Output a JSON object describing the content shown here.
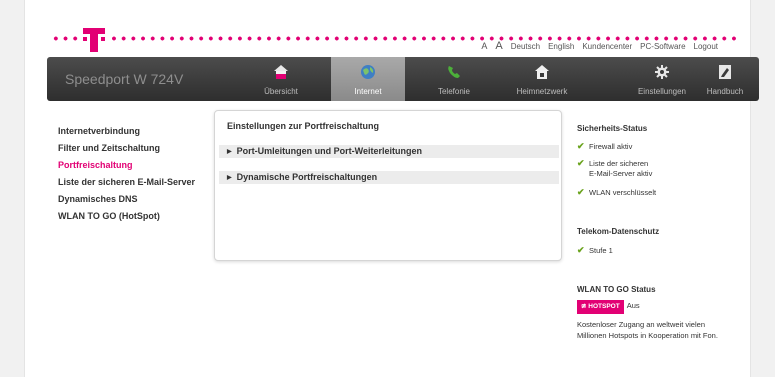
{
  "toplinks": {
    "a_small": "A",
    "a_large": "A",
    "items": [
      "Deutsch",
      "English",
      "Kundencenter",
      "PC-Software",
      "Logout"
    ]
  },
  "navbar": {
    "brand": "Speedport W 724V",
    "items": [
      {
        "label": "Übersicht",
        "icon": "house-icon",
        "active": false
      },
      {
        "label": "Internet",
        "icon": "globe-icon",
        "active": true
      },
      {
        "label": "Telefonie",
        "icon": "phone-icon",
        "active": false
      },
      {
        "label": "Heimnetzwerk",
        "icon": "home-network-icon",
        "active": false
      },
      {
        "label": "Einstellungen",
        "icon": "gear-icon",
        "active": false
      },
      {
        "label": "Handbuch",
        "icon": "manual-icon",
        "active": false
      }
    ]
  },
  "sidebar": {
    "items": [
      {
        "label": "Internetverbindung"
      },
      {
        "label": "Filter und Zeitschaltung"
      },
      {
        "label": "Portfreischaltung"
      },
      {
        "label": "Liste der sicheren E-Mail-Server"
      },
      {
        "label": "Dynamisches DNS"
      },
      {
        "label": "WLAN TO GO (HotSpot)"
      }
    ],
    "active_label": "Portfreischaltung"
  },
  "main": {
    "title": "Einstellungen zur Portfreischaltung",
    "sections": [
      {
        "label": "Port-Umleitungen und Port-Weiterleitungen"
      },
      {
        "label": "Dynamische Portfreischaltungen"
      }
    ]
  },
  "security": {
    "heading": "Sicherheits-Status",
    "items": [
      "Firewall aktiv",
      "Liste der sicheren",
      "E-Mail-Server aktiv",
      "WLAN verschlüsselt"
    ]
  },
  "privacy": {
    "heading": "Telekom-Datenschutz",
    "level": "Stufe 1"
  },
  "wlan_to_go": {
    "heading": "WLAN TO GO Status",
    "badge": "HOTSPOT",
    "status": "Aus",
    "desc_line1": "Kostenloser Zugang an weltweit vielen",
    "desc_line2": "Millionen Hotspots in Kooperation mit Fon."
  },
  "colors": {
    "magenta": "#e20074",
    "check_green": "#6aa31d",
    "navbar": "#3a3a3a"
  }
}
